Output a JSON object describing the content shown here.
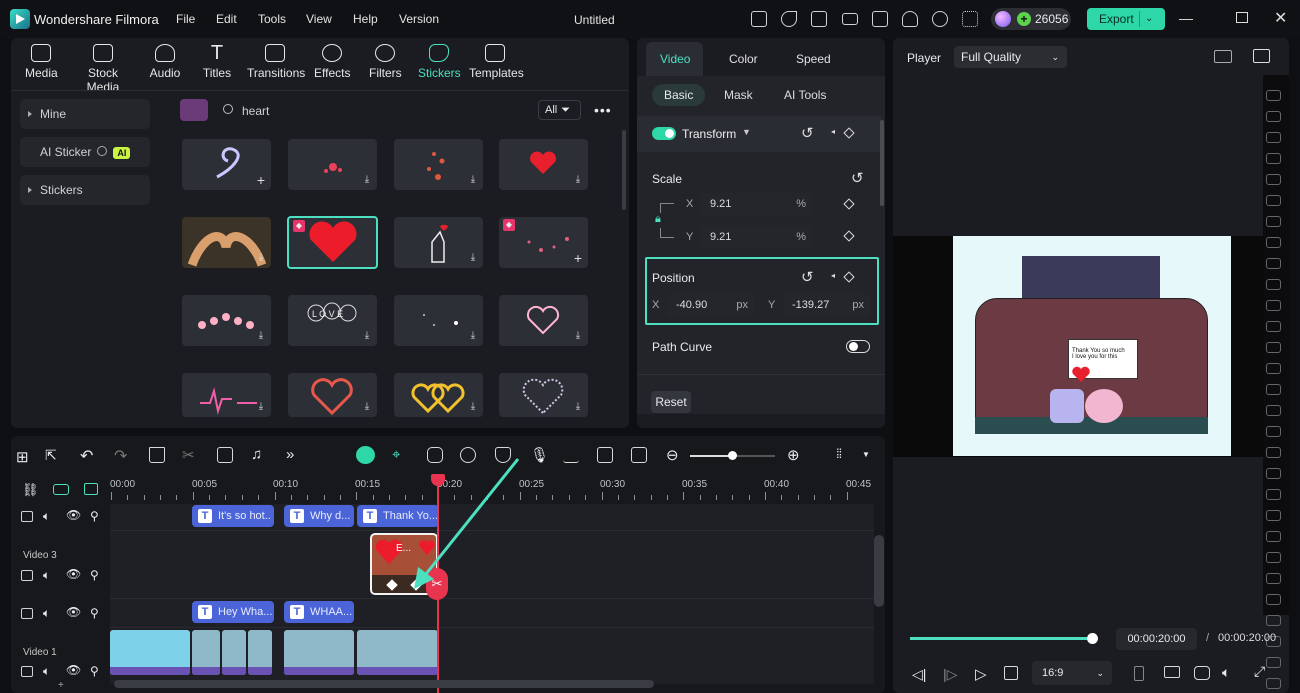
{
  "app": {
    "name": "Wondershare Filmora",
    "doc_title": "Untitled",
    "coins": "26056",
    "export_label": "Export"
  },
  "menu": [
    "File",
    "Edit",
    "Tools",
    "View",
    "Help",
    "Version"
  ],
  "toolbar": [
    "Media",
    "Stock Media",
    "Audio",
    "Titles",
    "Transitions",
    "Effects",
    "Filters",
    "Stickers",
    "Templates"
  ],
  "sidebar": {
    "mine": "Mine",
    "ai_sticker": "AI Sticker",
    "ai_badge": "AI",
    "stickers": "Stickers"
  },
  "search": {
    "value": "heart",
    "filter": "All"
  },
  "props": {
    "tabs": [
      "Video",
      "Color",
      "Speed"
    ],
    "subtabs": [
      "Basic",
      "Mask",
      "AI Tools"
    ],
    "transform": "Transform",
    "scale": "Scale",
    "scale_x": "9.21",
    "scale_y": "9.21",
    "x_label": "X",
    "y_label": "Y",
    "percent": "%",
    "position": "Position",
    "pos_x": "-40.90",
    "pos_y": "-139.27",
    "px": "px",
    "path_curve": "Path Curve",
    "reset": "Reset"
  },
  "player": {
    "label": "Player",
    "quality": "Full Quality",
    "current": "00:00:20:00",
    "total": "00:00:20:00",
    "sep": "/",
    "ratio": "16:9",
    "progress": 0.97,
    "bubble_line1": "Thank You so much",
    "bubble_line2": "I love you for this"
  },
  "timeline": {
    "ruler": [
      "00:00",
      "00:05",
      "00:10",
      "00:15",
      "00:20",
      "00:25",
      "00:30",
      "00:35",
      "00:40",
      "00:45"
    ],
    "tracks": {
      "video3": "Video 3",
      "video1": "Video 1"
    },
    "titles_top": [
      "It's so hot..",
      "Why d...",
      "Thank Yo..."
    ],
    "titles_mid": [
      "Hey Wha...",
      "WHAA..."
    ],
    "sticker_clip": "E..."
  },
  "colors": {
    "accent": "#2ed7a8",
    "highlight": "#4ce0c0",
    "playhead": "#e8344e",
    "title_clip": "#4b64d7"
  }
}
